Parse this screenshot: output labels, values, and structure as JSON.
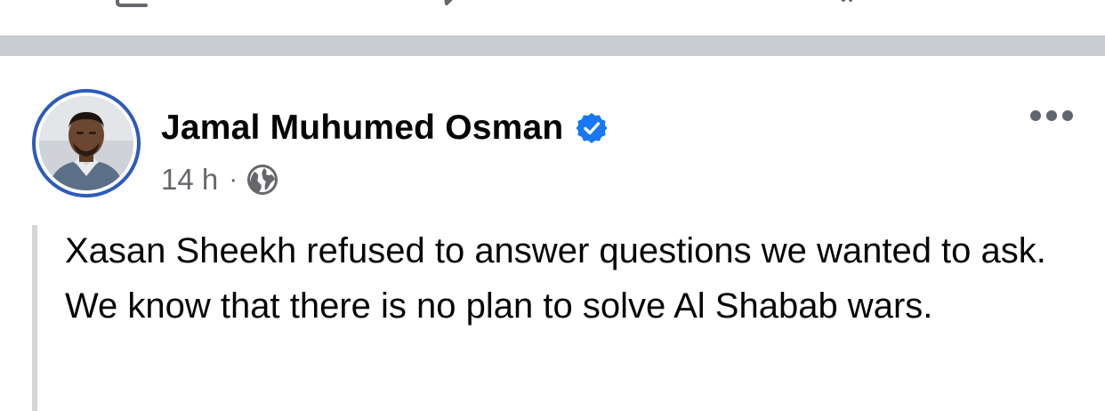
{
  "icons": {
    "action_left": "comment-icon",
    "action_center": "share-icon",
    "action_right": "send-icon",
    "verified": "verified-badge-icon",
    "audience": "globe-icon",
    "more": "more-options-icon"
  },
  "colors": {
    "avatar_ring": "#2d5bb9",
    "verified_badge": "#1877f2",
    "meta_text": "#65676b",
    "separator": "#c9ccd1"
  },
  "post": {
    "author": "Jamal Muhumed Osman",
    "timestamp": "14 h",
    "meta_separator": "·",
    "text": "Xasan Sheekh refused to answer questions we wanted to ask. We know that there is no plan to solve Al Shabab wars."
  }
}
